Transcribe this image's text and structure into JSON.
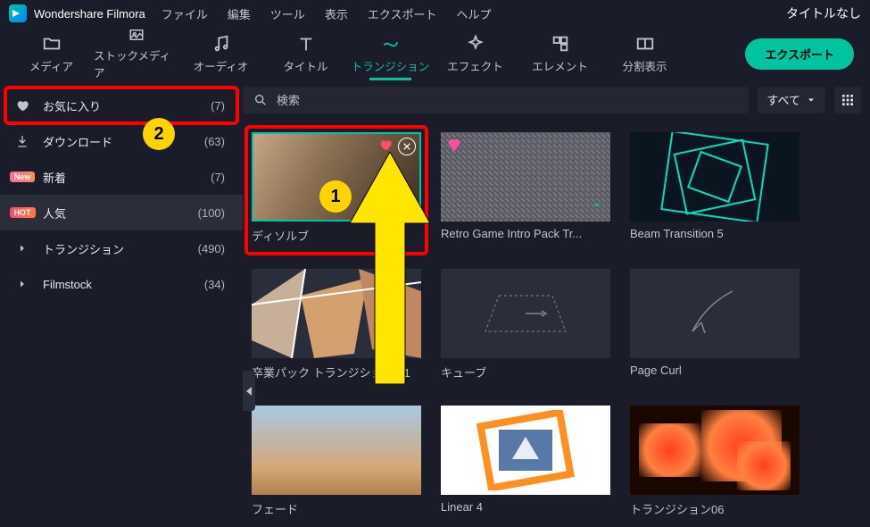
{
  "app": {
    "name": "Wondershare Filmora"
  },
  "menu": [
    "ファイル",
    "編集",
    "ツール",
    "表示",
    "エクスポート",
    "ヘルプ"
  ],
  "titlebar_right": "タイトルなし",
  "tabs": [
    {
      "id": "media",
      "label": "メディア"
    },
    {
      "id": "stock",
      "label": "ストックメディア"
    },
    {
      "id": "audio",
      "label": "オーディオ"
    },
    {
      "id": "title",
      "label": "タイトル"
    },
    {
      "id": "transition",
      "label": "トランジション",
      "active": true
    },
    {
      "id": "effect",
      "label": "エフェクト"
    },
    {
      "id": "element",
      "label": "エレメント"
    },
    {
      "id": "split",
      "label": "分割表示"
    }
  ],
  "export_label": "エクスポート",
  "sidebar": {
    "items": [
      {
        "icon": "heart",
        "label": "お気に入り",
        "count": "(7)",
        "highlight": true,
        "callout": "2"
      },
      {
        "icon": "download",
        "label": "ダウンロード",
        "count": "(63)"
      },
      {
        "badge": "New",
        "badge_class": "new",
        "label": "新着",
        "count": "(7)"
      },
      {
        "badge": "HOT",
        "badge_class": "hot",
        "label": "人気",
        "count": "(100)",
        "selected": true
      },
      {
        "icon": "chevron",
        "label": "トランジション",
        "count": "(490)"
      },
      {
        "icon": "chevron",
        "label": "Filmstock",
        "count": "(34)"
      }
    ]
  },
  "search": {
    "placeholder": "検索"
  },
  "filter": {
    "label": "すべて"
  },
  "grid": {
    "cards": [
      {
        "title": "ディソルブ",
        "art": "dissolve",
        "selected": true,
        "fav": true,
        "zoom": true,
        "plus": true,
        "callout": "1"
      },
      {
        "title": "Retro Game Intro Pack Tr...",
        "art": "retro",
        "gem": true,
        "dl": true
      },
      {
        "title": "Beam Transition 5",
        "art": "beam"
      },
      {
        "title": "卒業パック トランジション 01",
        "art": "grad"
      },
      {
        "title": "キューブ",
        "art": "cube"
      },
      {
        "title": "Page Curl",
        "art": "page"
      },
      {
        "title": "フェード",
        "art": "fade"
      },
      {
        "title": "Linear 4",
        "art": "linear"
      },
      {
        "title": "トランジション06",
        "art": "trans06"
      }
    ]
  }
}
